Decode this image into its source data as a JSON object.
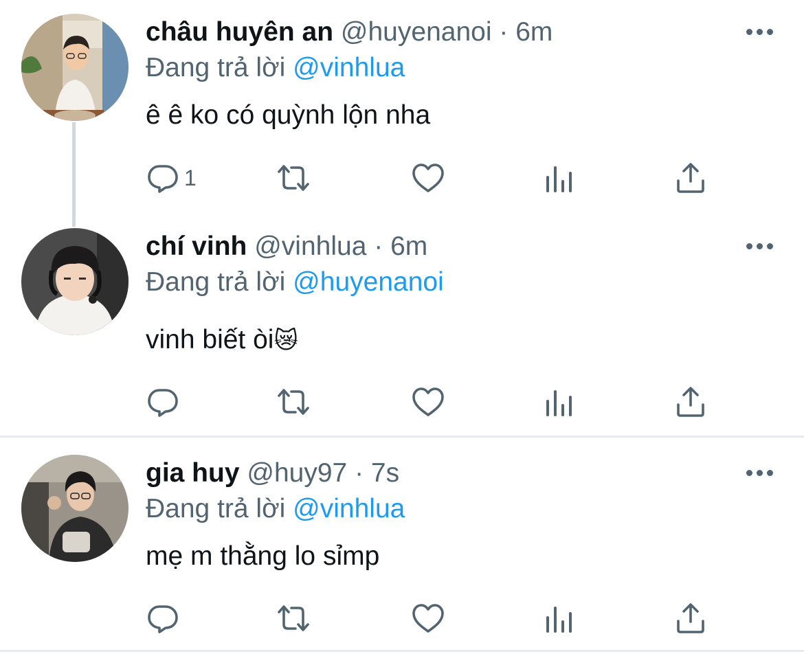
{
  "tweets": [
    {
      "name": "châu huyên an",
      "handle": "@huyenanoi",
      "separator": "·",
      "time": "6m",
      "reply_prefix": "Đang trả lời",
      "reply_to": "@vinhlua",
      "text": "ê ê ko có quỳnh lộn nha",
      "reply_count": "1"
    },
    {
      "name": "chí vinh",
      "handle": "@vinhlua",
      "separator": "·",
      "time": "6m",
      "reply_prefix": "Đang trả lời",
      "reply_to": "@huyenanoi",
      "text": "vinh biết òi",
      "emoji": "😿",
      "reply_count": ""
    },
    {
      "name": "gia huy",
      "handle": "@huy97",
      "separator": "·",
      "time": "7s",
      "reply_prefix": "Đang trả lời",
      "reply_to": "@vinhlua",
      "text": "mẹ m thằng lo sỉmp",
      "reply_count": ""
    }
  ],
  "icons": {
    "reply": "speech-bubble-icon",
    "retweet": "retweet-arrows-icon",
    "like": "heart-outline-icon",
    "analytics": "bar-chart-icon",
    "share": "share-upload-icon",
    "more": "more-dots-icon"
  },
  "colors": {
    "text": "#0f1419",
    "secondary": "#536471",
    "accent": "#1d9bf0",
    "divider": "#e6ecf0"
  }
}
